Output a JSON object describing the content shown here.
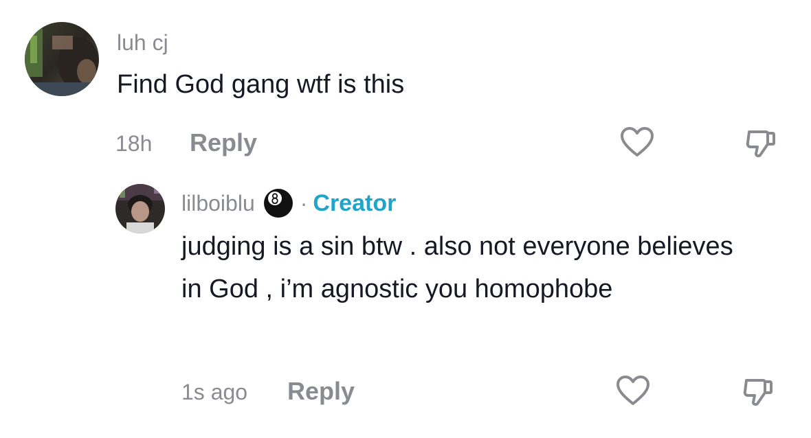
{
  "comment": {
    "username": "luh cj",
    "text": "Find God gang wtf is this",
    "time": "18h",
    "reply_label": "Reply"
  },
  "reply": {
    "username": "lilboiblu",
    "badge_separator": "·",
    "creator_label": "Creator",
    "text": "judging is a sin btw . also not everyone believes in God , i’m agnostic you homophobe",
    "time": "1s ago",
    "reply_label": "Reply"
  },
  "colors": {
    "muted_text": "#8a8b91",
    "body_text": "#161823",
    "creator_accent": "#20a4c8"
  },
  "icons": [
    "avatar-photo",
    "heart-icon",
    "dislike-icon",
    "eight-ball-emoji"
  ]
}
